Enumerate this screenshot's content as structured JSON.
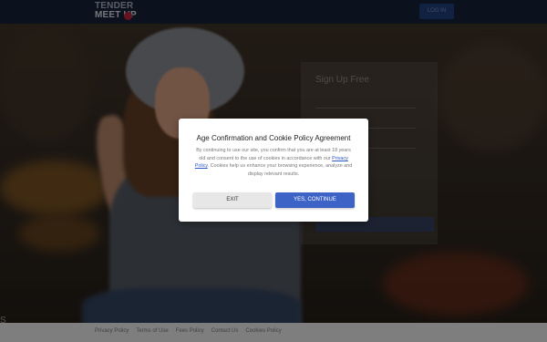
{
  "header": {
    "logo_line1": "TENDER",
    "logo_line2": "MEET UP",
    "login_label": "LOG IN"
  },
  "background": {
    "signup_title": "Sign Up Free",
    "edge_text": "S"
  },
  "modal": {
    "title": "Age Confirmation and Cookie Policy Agreement",
    "body_part1": "By continuing to use our site, you confirm that you are at least 18 years old and consent to the use of cookies in accordance with our ",
    "privacy_link": "Privacy Policy",
    "body_part2": ". Cookies help us enhance your browsing experience, analyze and display relevant results.",
    "exit_label": "EXIT",
    "confirm_label": "YES, CONTINUE"
  },
  "footer": {
    "links": [
      "Privacy Policy",
      "Terms of Use",
      "Fees Policy",
      "Contact Us",
      "Cookies Policy"
    ]
  },
  "colors": {
    "header_bg": "#152032",
    "accent": "#3d63c7",
    "link": "#2f59c5"
  }
}
